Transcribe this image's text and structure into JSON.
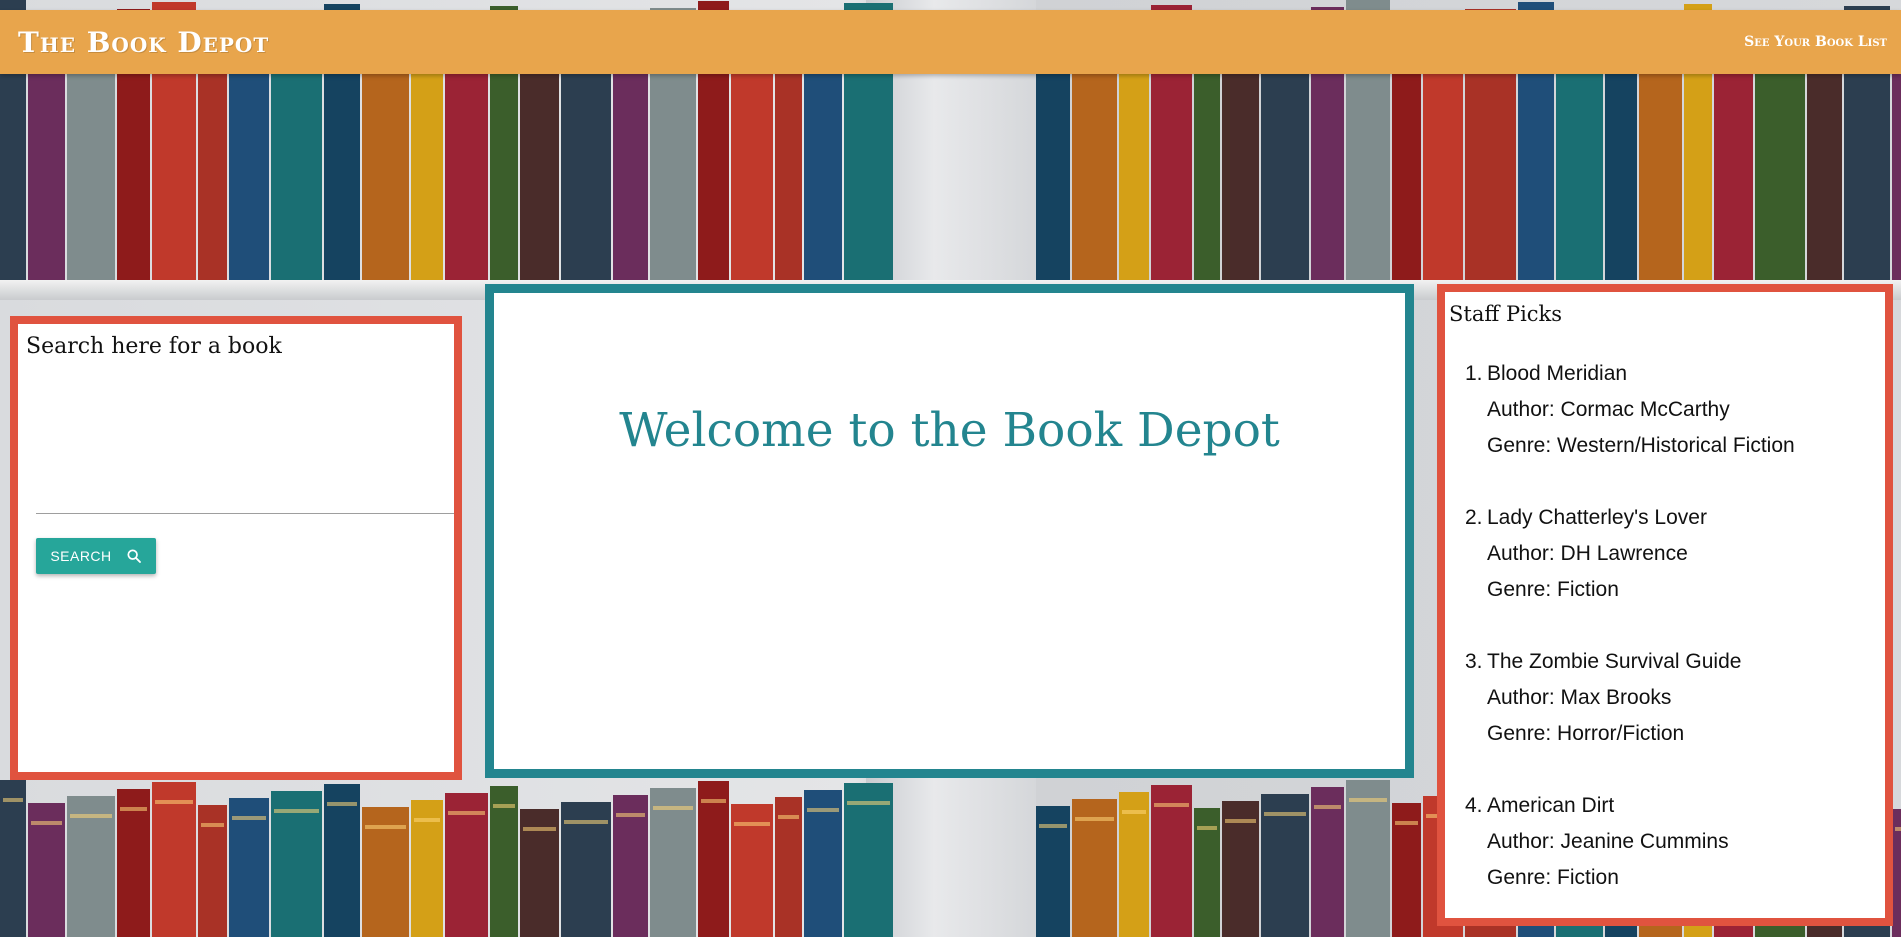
{
  "navbar": {
    "brand": "The Book Depot",
    "link": "See Your Book List"
  },
  "search": {
    "title": "Search here for a book",
    "input_value": "",
    "input_placeholder": "",
    "button_label": "SEARCH",
    "button_icon": "search-icon"
  },
  "welcome": {
    "title": "Welcome to the Book Depot"
  },
  "staff_picks": {
    "title": "Staff Picks",
    "items": [
      {
        "number": "1.",
        "title": "Blood Meridian",
        "author": "Author: Cormac McCarthy",
        "genre": "Genre: Western/Historical Fiction"
      },
      {
        "number": "2.",
        "title": "Lady Chatterley's Lover",
        "author": "Author: DH Lawrence",
        "genre": "Genre: Fiction"
      },
      {
        "number": "3.",
        "title": "The Zombie Survival Guide",
        "author": "Author: Max Brooks",
        "genre": "Genre: Horror/Fiction"
      },
      {
        "number": "4.",
        "title": "American Dirt",
        "author": "Author: Jeanine Cummins",
        "genre": "Genre: Fiction"
      }
    ]
  },
  "colors": {
    "navbar": "#e8a54c",
    "search_border": "#e0533f",
    "welcome_border": "#23858f",
    "button": "#26a69a"
  }
}
